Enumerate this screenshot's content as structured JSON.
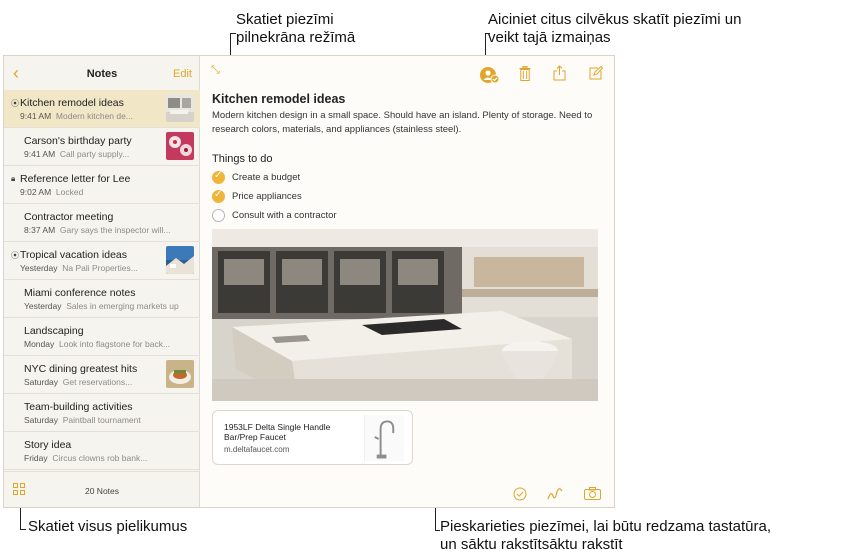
{
  "callouts": {
    "fullscreen": [
      "Skatiet piezīmi",
      "pilnekrāna režīmā"
    ],
    "collaborate": [
      "Aiciniet citus cilvēkus skatīt piezīmi un",
      "veikt tajā izmaiņas"
    ],
    "attachments": "Skatiet visus pielikumus",
    "keyboard": [
      "Pieskarieties piezīmei, lai būtu redzama tastatūra,",
      "un sāktu rakstītsāktu rakstīt"
    ]
  },
  "sidebar": {
    "title": "Notes",
    "edit_label": "Edit",
    "count_label": "20 Notes",
    "notes": [
      {
        "title": "Kitchen remodel ideas",
        "time": "9:41 AM",
        "preview": "Modern kitchen de...",
        "icon": "people-icon",
        "selected": true
      },
      {
        "title": "Carson's birthday party",
        "time": "9:41 AM",
        "preview": "Call party supply...",
        "icon": "",
        "selected": false
      },
      {
        "title": "Reference letter for Lee",
        "time": "9:02 AM",
        "preview": "Locked",
        "icon": "lock-icon",
        "selected": false
      },
      {
        "title": "Contractor meeting",
        "time": "8:37 AM",
        "preview": "Gary says the inspector will...",
        "icon": "",
        "selected": false
      },
      {
        "title": "Tropical vacation ideas",
        "time": "Yesterday",
        "preview": "Na Pali Properties...",
        "icon": "people-icon",
        "selected": false
      },
      {
        "title": "Miami conference notes",
        "time": "Yesterday",
        "preview": "Sales in emerging markets up",
        "icon": "",
        "selected": false
      },
      {
        "title": "Landscaping",
        "time": "Monday",
        "preview": "Look into flagstone for back...",
        "icon": "",
        "selected": false
      },
      {
        "title": "NYC dining greatest hits",
        "time": "Saturday",
        "preview": "Get reservations...",
        "icon": "",
        "selected": false
      },
      {
        "title": "Team-building activities",
        "time": "Saturday",
        "preview": "Paintball tournament",
        "icon": "",
        "selected": false
      },
      {
        "title": "Story idea",
        "time": "Friday",
        "preview": "Circus clowns rob bank...",
        "icon": "",
        "selected": false
      }
    ]
  },
  "note": {
    "title": "Kitchen remodel ideas",
    "body": "Modern kitchen design in a small space. Should have an island. Plenty of storage. Need to research colors, materials, and appliances (stainless steel).",
    "checklist_title": "Things to do",
    "checklist": [
      {
        "label": "Create a budget",
        "checked": true
      },
      {
        "label": "Price appliances",
        "checked": true
      },
      {
        "label": "Consult with a contractor",
        "checked": false
      }
    ],
    "link": {
      "title": "1953LF Delta Single Handle Bar/Prep Faucet",
      "url": "m.deltafaucet.com"
    }
  },
  "colors": {
    "accent": "#e2a52a",
    "selected_row": "#f1e6c6"
  }
}
